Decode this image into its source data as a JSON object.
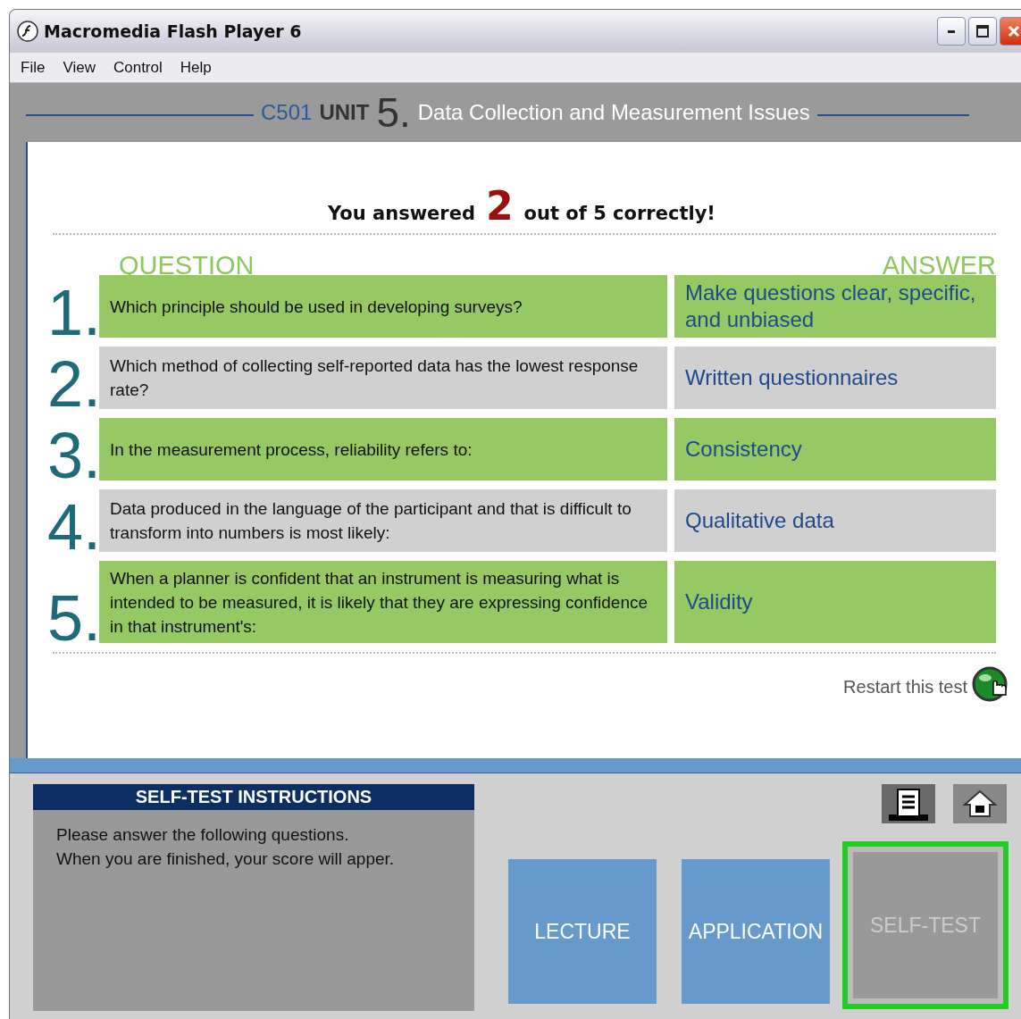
{
  "window": {
    "title": "Macromedia Flash Player 6"
  },
  "menu": [
    "File",
    "View",
    "Control",
    "Help"
  ],
  "header": {
    "course": "C501",
    "unit_label": "UNIT",
    "unit_number": "5.",
    "title": "Data Collection and Measurement Issues"
  },
  "score": {
    "before": "You answered",
    "correct": "2",
    "after": "out of 5 correctly!"
  },
  "columns": {
    "question": "QUESTION",
    "answer": "ANSWER"
  },
  "rows": [
    {
      "number": "1.",
      "question": "Which principle should be used in developing surveys?",
      "answer": "Make questions clear, specific, and unbiased",
      "highlight": true
    },
    {
      "number": "2.",
      "question": "Which method of collecting self-reported data has the lowest response rate?",
      "answer": "Written questionnaires",
      "highlight": false
    },
    {
      "number": "3.",
      "question": "In the measurement process, reliability refers to:",
      "answer": "Consistency",
      "highlight": true
    },
    {
      "number": "4.",
      "question": "Data produced in the language of the participant and that is difficult to transform into numbers is most likely:",
      "answer": "Qualitative data",
      "highlight": false
    },
    {
      "number": "5.",
      "question": "When a planner is confident that an instrument is measuring what is intended to be measured, it is likely that they are expressing confidence in that instrument's:",
      "answer": "Validity",
      "highlight": true
    }
  ],
  "restart": "Restart this test",
  "instructions": {
    "title": "SELF-TEST INSTRUCTIONS",
    "lines": [
      "Please answer the following questions.",
      "When you are finished, your score will apper."
    ]
  },
  "nav": [
    {
      "label": "LECTURE",
      "selected": false
    },
    {
      "label": "APPLICATION",
      "selected": false
    },
    {
      "label": "SELF-TEST",
      "selected": true
    }
  ]
}
